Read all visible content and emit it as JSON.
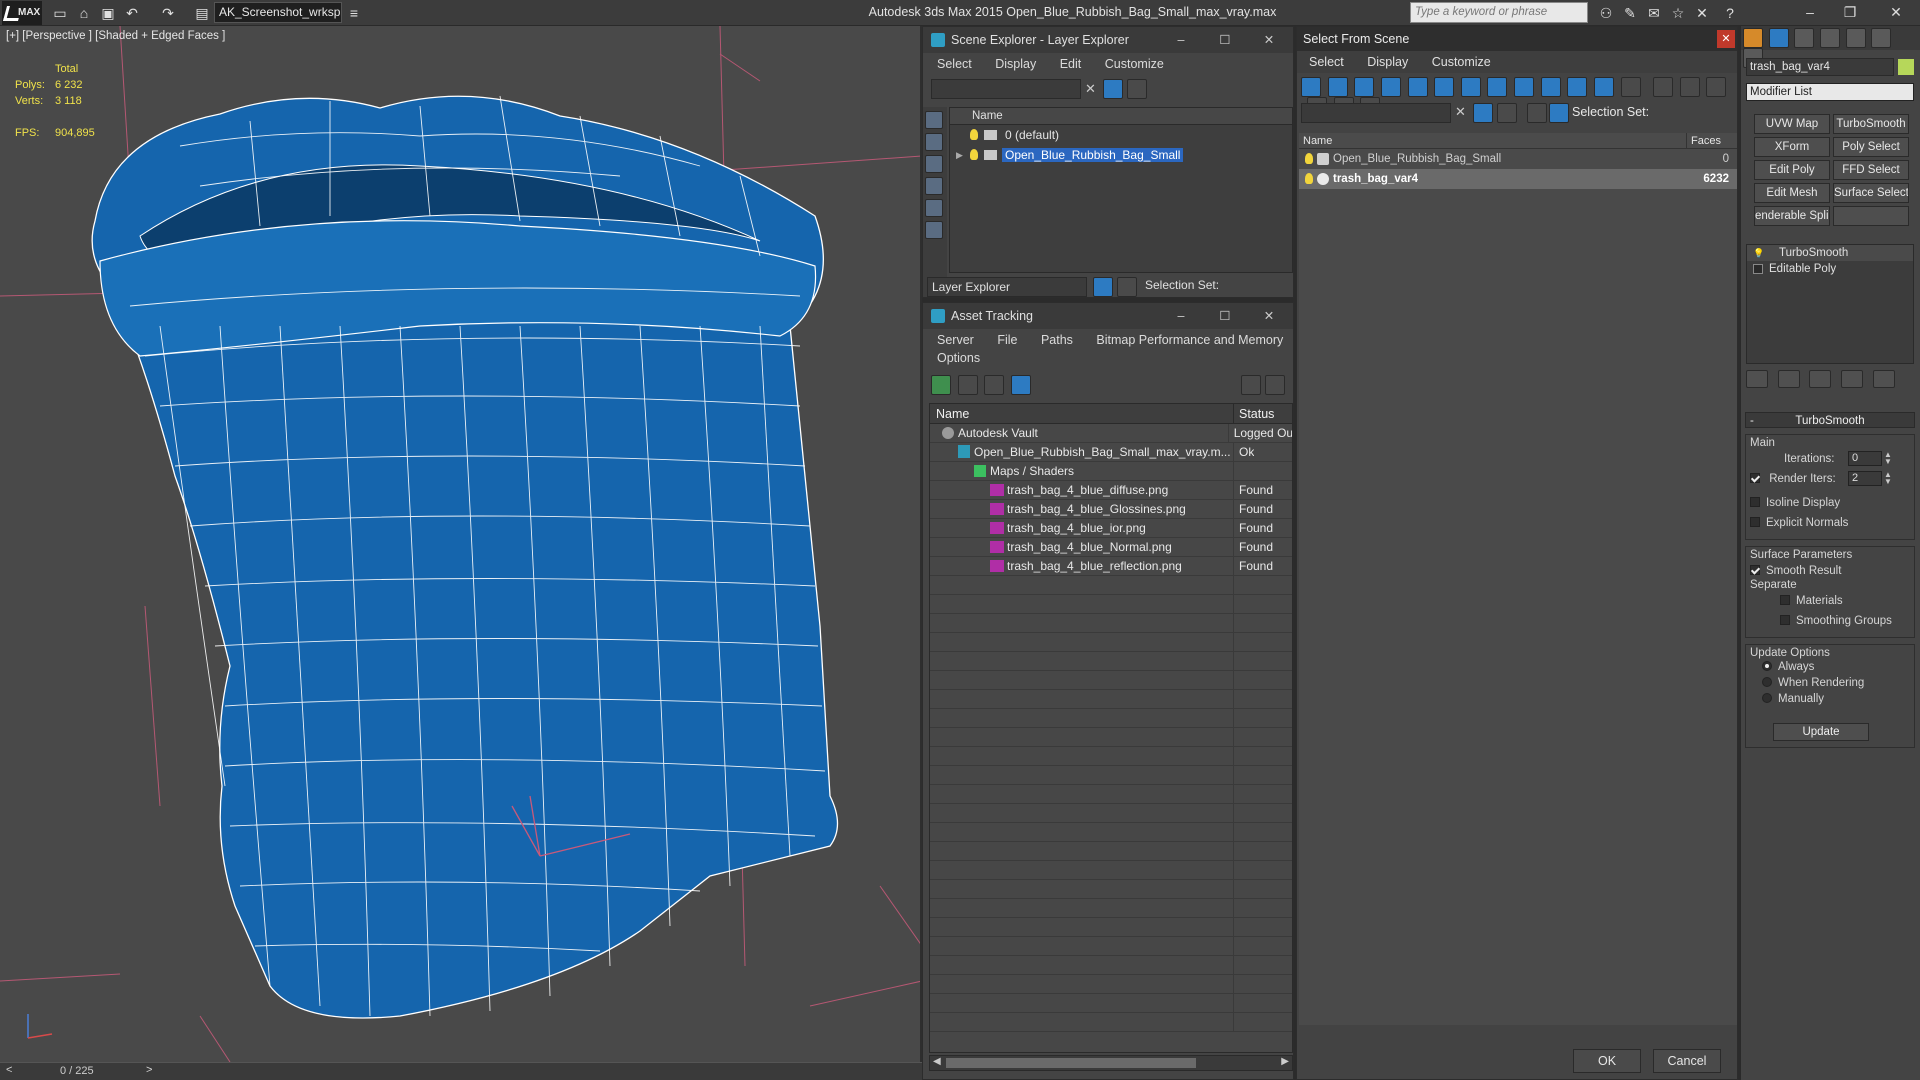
{
  "titlebar": {
    "workspace": "AK_Screenshot_wrksp",
    "app_title": "Autodesk 3ds Max  2015    Open_Blue_Rubbish_Bag_Small_max_vray.max",
    "search_placeholder": "Type a keyword or phrase",
    "logo": "MAX"
  },
  "viewport": {
    "label": "[+] [Perspective ] [Shaded + Edged Faces ]",
    "stats": {
      "total_label": "Total",
      "polys_label": "Polys:",
      "polys_value": "6 232",
      "verts_label": "Verts:",
      "verts_value": "3 118",
      "fps_label": "FPS:",
      "fps_value": "904,895"
    },
    "mesh_color": "#1565ad",
    "wire_color": "#ffffff"
  },
  "timebar": {
    "frame": "0 / 225",
    "prev": "<",
    "next": ">"
  },
  "scene_explorer": {
    "title": "Scene Explorer - Layer Explorer",
    "menu": [
      "Select",
      "Display",
      "Edit",
      "Customize"
    ],
    "column": "Name",
    "rows": [
      {
        "label": "0 (default)",
        "selected": false
      },
      {
        "label": "Open_Blue_Rubbish_Bag_Small",
        "selected": true
      }
    ],
    "explorer_combo": "Layer Explorer",
    "selection_set_label": "Selection Set:"
  },
  "asset_tracking": {
    "title": "Asset Tracking",
    "menu": [
      "Server",
      "File",
      "Paths",
      "Bitmap Performance and Memory"
    ],
    "menu2": "Options",
    "col_name": "Name",
    "col_status": "Status",
    "rows": [
      {
        "name": "Autodesk Vault",
        "status": "Logged Ou",
        "indent": 1,
        "icon": "vault"
      },
      {
        "name": "Open_Blue_Rubbish_Bag_Small_max_vray.m...",
        "status": "Ok",
        "indent": 2,
        "icon": "max"
      },
      {
        "name": "Maps / Shaders",
        "status": "",
        "indent": 3,
        "icon": "folder"
      },
      {
        "name": "trash_bag_4_blue_diffuse.png",
        "status": "Found",
        "indent": 4,
        "icon": "png"
      },
      {
        "name": "trash_bag_4_blue_Glossines.png",
        "status": "Found",
        "indent": 4,
        "icon": "png"
      },
      {
        "name": "trash_bag_4_blue_ior.png",
        "status": "Found",
        "indent": 4,
        "icon": "png"
      },
      {
        "name": "trash_bag_4_blue_Normal.png",
        "status": "Found",
        "indent": 4,
        "icon": "png"
      },
      {
        "name": "trash_bag_4_blue_reflection.png",
        "status": "Found",
        "indent": 4,
        "icon": "png"
      }
    ]
  },
  "select_from_scene": {
    "title": "Select From Scene",
    "menu": [
      "Select",
      "Display",
      "Customize"
    ],
    "selection_set_label": "Selection Set:",
    "col_name": "Name",
    "col_faces": "Faces",
    "rows": [
      {
        "name": "Open_Blue_Rubbish_Bag_Small",
        "faces": "0",
        "selected": false
      },
      {
        "name": "trash_bag_var4",
        "faces": "6232",
        "selected": true
      }
    ],
    "ok": "OK",
    "cancel": "Cancel"
  },
  "command_panel": {
    "object_name": "trash_bag_var4",
    "modifier_list": "Modifier List",
    "buttons": [
      "UVW Map",
      "TurboSmooth",
      "XForm",
      "Poly Select",
      "Edit Poly",
      "FFD Select",
      "Edit Mesh",
      "Surface Select",
      "enderable Splir",
      ""
    ],
    "stack": [
      "TurboSmooth",
      "Editable Poly"
    ],
    "rollout_title": "TurboSmooth",
    "main_label": "Main",
    "iterations_label": "Iterations:",
    "iterations_value": "0",
    "render_iters_label": "Render Iters:",
    "render_iters_value": "2",
    "isoline": "Isoline Display",
    "explicit_normals": "Explicit Normals",
    "surface_params": "Surface Parameters",
    "smooth_result": "Smooth Result",
    "separate": "Separate",
    "materials": "Materials",
    "smoothing_groups": "Smoothing Groups",
    "update_options": "Update Options",
    "always": "Always",
    "when_rendering": "When Rendering",
    "manually": "Manually",
    "update": "Update"
  }
}
